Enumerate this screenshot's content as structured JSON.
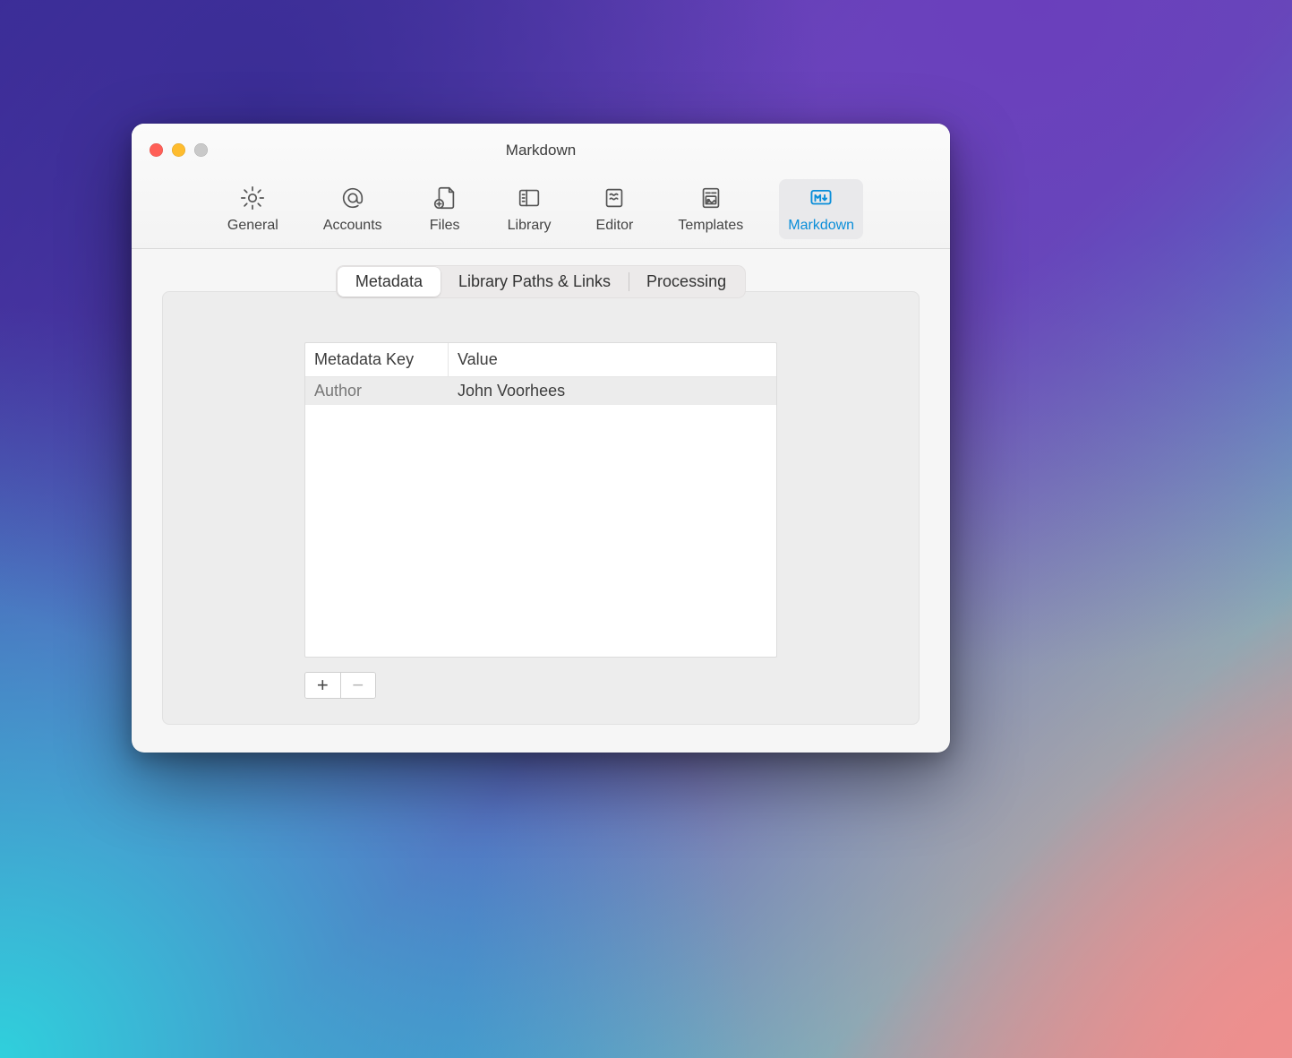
{
  "window": {
    "title": "Markdown"
  },
  "toolbar": {
    "items": [
      {
        "id": "general",
        "label": "General",
        "icon": "gear-icon"
      },
      {
        "id": "accounts",
        "label": "Accounts",
        "icon": "at-icon"
      },
      {
        "id": "files",
        "label": "Files",
        "icon": "file-plus-icon"
      },
      {
        "id": "library",
        "label": "Library",
        "icon": "sidebar-icon"
      },
      {
        "id": "editor",
        "label": "Editor",
        "icon": "editor-lines-icon"
      },
      {
        "id": "templates",
        "label": "Templates",
        "icon": "template-icon"
      },
      {
        "id": "markdown",
        "label": "Markdown",
        "icon": "markdown-icon"
      }
    ],
    "active_id": "markdown"
  },
  "tabs": {
    "items": [
      {
        "id": "metadata",
        "label": "Metadata"
      },
      {
        "id": "paths",
        "label": "Library Paths & Links"
      },
      {
        "id": "processing",
        "label": "Processing"
      }
    ],
    "active_id": "metadata"
  },
  "table": {
    "columns": {
      "key": "Metadata Key",
      "value": "Value"
    },
    "rows": [
      {
        "key": "Author",
        "value": "John Voorhees"
      }
    ]
  },
  "buttons": {
    "add_label": "+",
    "remove_label": "−",
    "remove_enabled": false
  }
}
